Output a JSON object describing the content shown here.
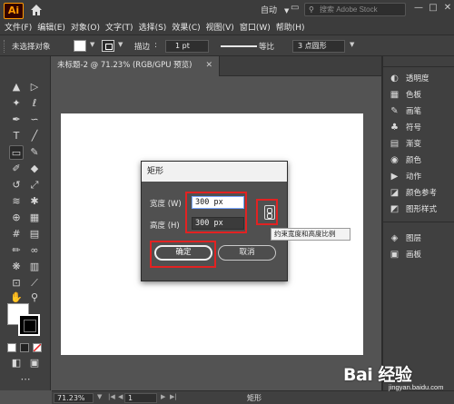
{
  "app": {
    "logo_text": "Ai"
  },
  "workspace": {
    "label": "自动"
  },
  "stock_search": {
    "placeholder": "搜索 Adobe Stock"
  },
  "menu": [
    "文件(F)",
    "编辑(E)",
    "对象(O)",
    "文字(T)",
    "选择(S)",
    "效果(C)",
    "视图(V)",
    "窗口(W)",
    "帮助(H)"
  ],
  "control_bar": {
    "selection_label": "未选择对象",
    "stroke_label": "描边",
    "stroke_weight": "1 pt",
    "stroke_profile": "等比",
    "brush_label": "3 点圆形"
  },
  "document_tab": {
    "title": "未标题-2 @ 71.23% (RGB/GPU 预览)"
  },
  "right_panel": {
    "items": [
      {
        "icon": "circle-icon",
        "label": "透明度"
      },
      {
        "icon": "swatches-icon",
        "label": "色板"
      },
      {
        "icon": "brush-icon",
        "label": "画笔"
      },
      {
        "icon": "club-icon",
        "label": "符号"
      },
      {
        "icon": "gradient-icon",
        "label": "渐变"
      },
      {
        "icon": "color-icon",
        "label": "颜色"
      },
      {
        "icon": "play-icon",
        "label": "动作"
      },
      {
        "icon": "color-guide-icon",
        "label": "颜色参考"
      },
      {
        "icon": "graphic-style-icon",
        "label": "图形样式"
      },
      {
        "icon": "layers-icon",
        "label": "图层"
      },
      {
        "icon": "artboard-icon",
        "label": "画板"
      }
    ]
  },
  "status_bar": {
    "zoom": "71.23%",
    "page": "1",
    "tool": "矩形"
  },
  "dialog": {
    "title": "矩形",
    "width_label": "宽度 (W)",
    "width_value": "300 px",
    "height_label": "高度 (H)",
    "height_value": "300 px",
    "ok_label": "确定",
    "cancel_label": "取消"
  },
  "tooltip": {
    "text": "约束宽度和高度比例"
  },
  "watermark": {
    "main": "Bai 经验",
    "sub": "jingyan.baidu.com"
  },
  "colors": {
    "annotation_red": "#e22222",
    "ui_dark": "#404040",
    "canvas_bg": "#535353"
  }
}
